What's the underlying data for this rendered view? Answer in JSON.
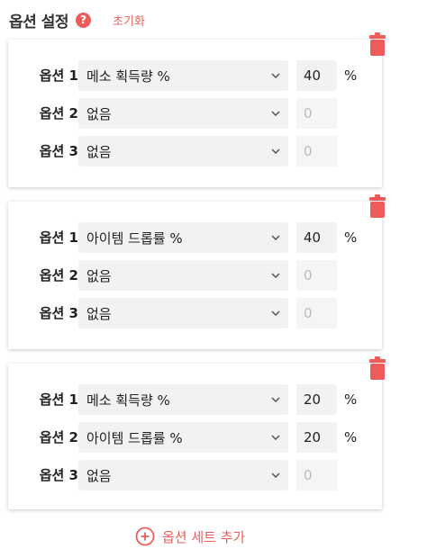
{
  "header": {
    "title": "옵션 설정",
    "help_icon": "?",
    "reset_label": "초기화"
  },
  "colors": {
    "accent": "#ee5b5b",
    "field_bg": "#f2f2f2"
  },
  "sets": [
    {
      "options": [
        {
          "label": "옵션 1",
          "select": "메소 획득량 %",
          "value": "40",
          "unit": "%"
        },
        {
          "label": "옵션 2",
          "select": "없음",
          "value": "0",
          "unit": ""
        },
        {
          "label": "옵션 3",
          "select": "없음",
          "value": "0",
          "unit": ""
        }
      ]
    },
    {
      "options": [
        {
          "label": "옵션 1",
          "select": "아이템 드롭률 %",
          "value": "40",
          "unit": "%"
        },
        {
          "label": "옵션 2",
          "select": "없음",
          "value": "0",
          "unit": ""
        },
        {
          "label": "옵션 3",
          "select": "없음",
          "value": "0",
          "unit": ""
        }
      ]
    },
    {
      "options": [
        {
          "label": "옵션 1",
          "select": "메소 획득량 %",
          "value": "20",
          "unit": "%"
        },
        {
          "label": "옵션 2",
          "select": "아이템 드롭률 %",
          "value": "20",
          "unit": "%"
        },
        {
          "label": "옵션 3",
          "select": "없음",
          "value": "0",
          "unit": ""
        }
      ]
    }
  ],
  "add_set_label": "옵션 세트 추가"
}
